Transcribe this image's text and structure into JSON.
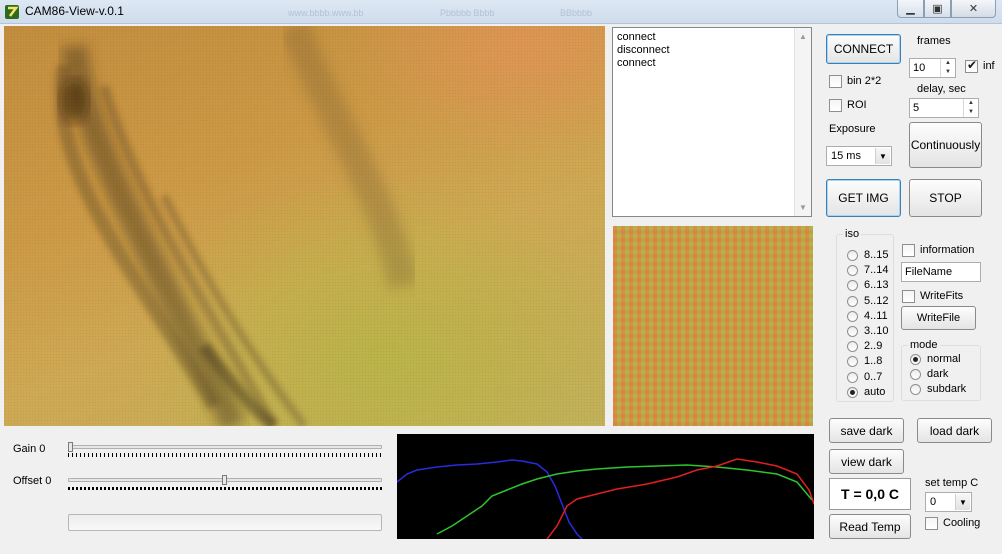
{
  "window": {
    "title": "CAM86-View-v.0.1",
    "blurred_tabs": [
      "www.bbbb.www.bb",
      "Pbbbbb Bbbb",
      "BBbbbb"
    ]
  },
  "log": {
    "lines": [
      "connect",
      "disconnect",
      "connect"
    ]
  },
  "controls": {
    "connect": "CONNECT",
    "frames_label": "frames",
    "frames_value": "10",
    "inf_label": "inf",
    "inf_checked": true,
    "bin_label": "bin 2*2",
    "roi_label": "ROI",
    "delay_label": "delay, sec",
    "delay_value": "5",
    "exposure_label": "Exposure",
    "exposure_value": "15 ms",
    "continuously": "Continuously",
    "get_img": "GET IMG",
    "stop": "STOP"
  },
  "iso": {
    "title": "iso",
    "options": [
      "8..15",
      "7..14",
      "6..13",
      "5..12",
      "4..11",
      "3..10",
      "2..9",
      "1..8",
      "0..7",
      "auto"
    ],
    "selected": "auto"
  },
  "file": {
    "information_label": "information",
    "filename_value": "FileName",
    "writefits_label": "WriteFits",
    "writefile_button": "WriteFile"
  },
  "mode": {
    "title": "mode",
    "options": [
      "normal",
      "dark",
      "subdark"
    ],
    "selected": "normal"
  },
  "adjust": {
    "gain_label": "Gain 0",
    "gain_level": 0,
    "offset_label": "Offset 0",
    "offset_level": 0.5
  },
  "dark": {
    "save_dark": "save dark",
    "load_dark": "load dark",
    "view_dark": "view dark"
  },
  "temperature": {
    "display": "T = 0,0 C",
    "read_temp": "Read Temp",
    "set_temp_label": "set temp C",
    "set_temp_value": "0",
    "cooling_label": "Cooling"
  },
  "colors": {
    "histogram_red": "#e02020",
    "histogram_green": "#2ec42e",
    "histogram_blue": "#2a2ae0",
    "histogram_bg": "#000000"
  }
}
